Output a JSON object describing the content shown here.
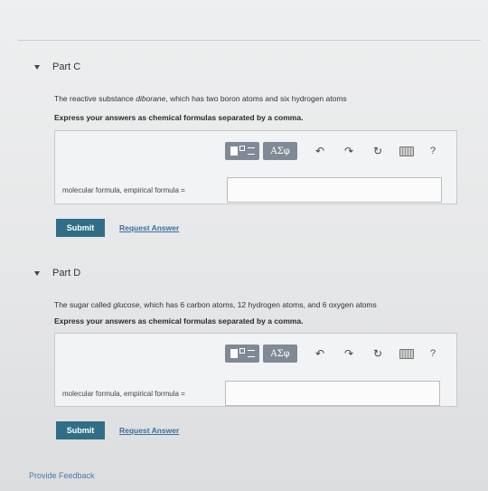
{
  "parts": [
    {
      "title": "Part C",
      "question_prefix": "The reactive substance ",
      "question_term": "diborane",
      "question_suffix": ", which has two boron atoms and six hydrogen atoms",
      "instruction": "Express your answers as chemical formulas separated by a comma.",
      "answer_label": "molecular formula, empirical formula =",
      "answer_value": "",
      "submit_label": "Submit",
      "request_label": "Request Answer"
    },
    {
      "title": "Part D",
      "question_prefix": "The sugar called ",
      "question_term": "glucose",
      "question_suffix": ", which has 6 carbon atoms, 12 hydrogen atoms, and 6 oxygen atoms",
      "instruction": "Express your answers as chemical formulas separated by a comma.",
      "answer_label": "molecular formula, empirical formula =",
      "answer_value": "",
      "submit_label": "Submit",
      "request_label": "Request Answer"
    }
  ],
  "toolbar": {
    "greek_label": "ΑΣφ",
    "undo_glyph": "↶",
    "redo_glyph": "↷",
    "reset_glyph": "↻",
    "help_label": "?"
  },
  "footer": {
    "feedback_label": "Provide Feedback"
  },
  "colors": {
    "submit_bg": "#2f6e86",
    "link": "#3b6f9e",
    "toolbar_btn": "#7f8a96"
  }
}
